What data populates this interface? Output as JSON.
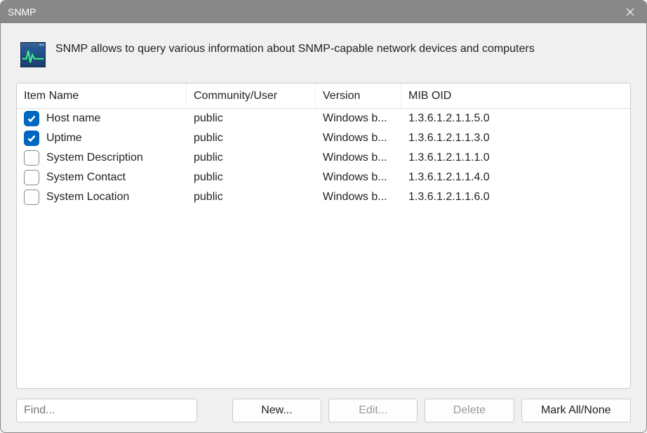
{
  "window": {
    "title": "SNMP"
  },
  "intro": {
    "text": "SNMP allows to query various information about SNMP-capable network devices and computers"
  },
  "table": {
    "headers": {
      "name": "Item Name",
      "community": "Community/User",
      "version": "Version",
      "oid": "MIB OID"
    },
    "rows": [
      {
        "checked": true,
        "name": "Host name",
        "community": "public",
        "version": "Windows b...",
        "oid": "1.3.6.1.2.1.1.5.0"
      },
      {
        "checked": true,
        "name": "Uptime",
        "community": "public",
        "version": "Windows b...",
        "oid": "1.3.6.1.2.1.1.3.0"
      },
      {
        "checked": false,
        "name": "System Description",
        "community": "public",
        "version": "Windows b...",
        "oid": "1.3.6.1.2.1.1.1.0"
      },
      {
        "checked": false,
        "name": "System Contact",
        "community": "public",
        "version": "Windows b...",
        "oid": "1.3.6.1.2.1.1.4.0"
      },
      {
        "checked": false,
        "name": "System Location",
        "community": "public",
        "version": "Windows b...",
        "oid": "1.3.6.1.2.1.1.6.0"
      }
    ]
  },
  "bottom": {
    "find_placeholder": "Find...",
    "new_label": "New...",
    "edit_label": "Edit...",
    "delete_label": "Delete",
    "mark_label": "Mark All/None"
  }
}
